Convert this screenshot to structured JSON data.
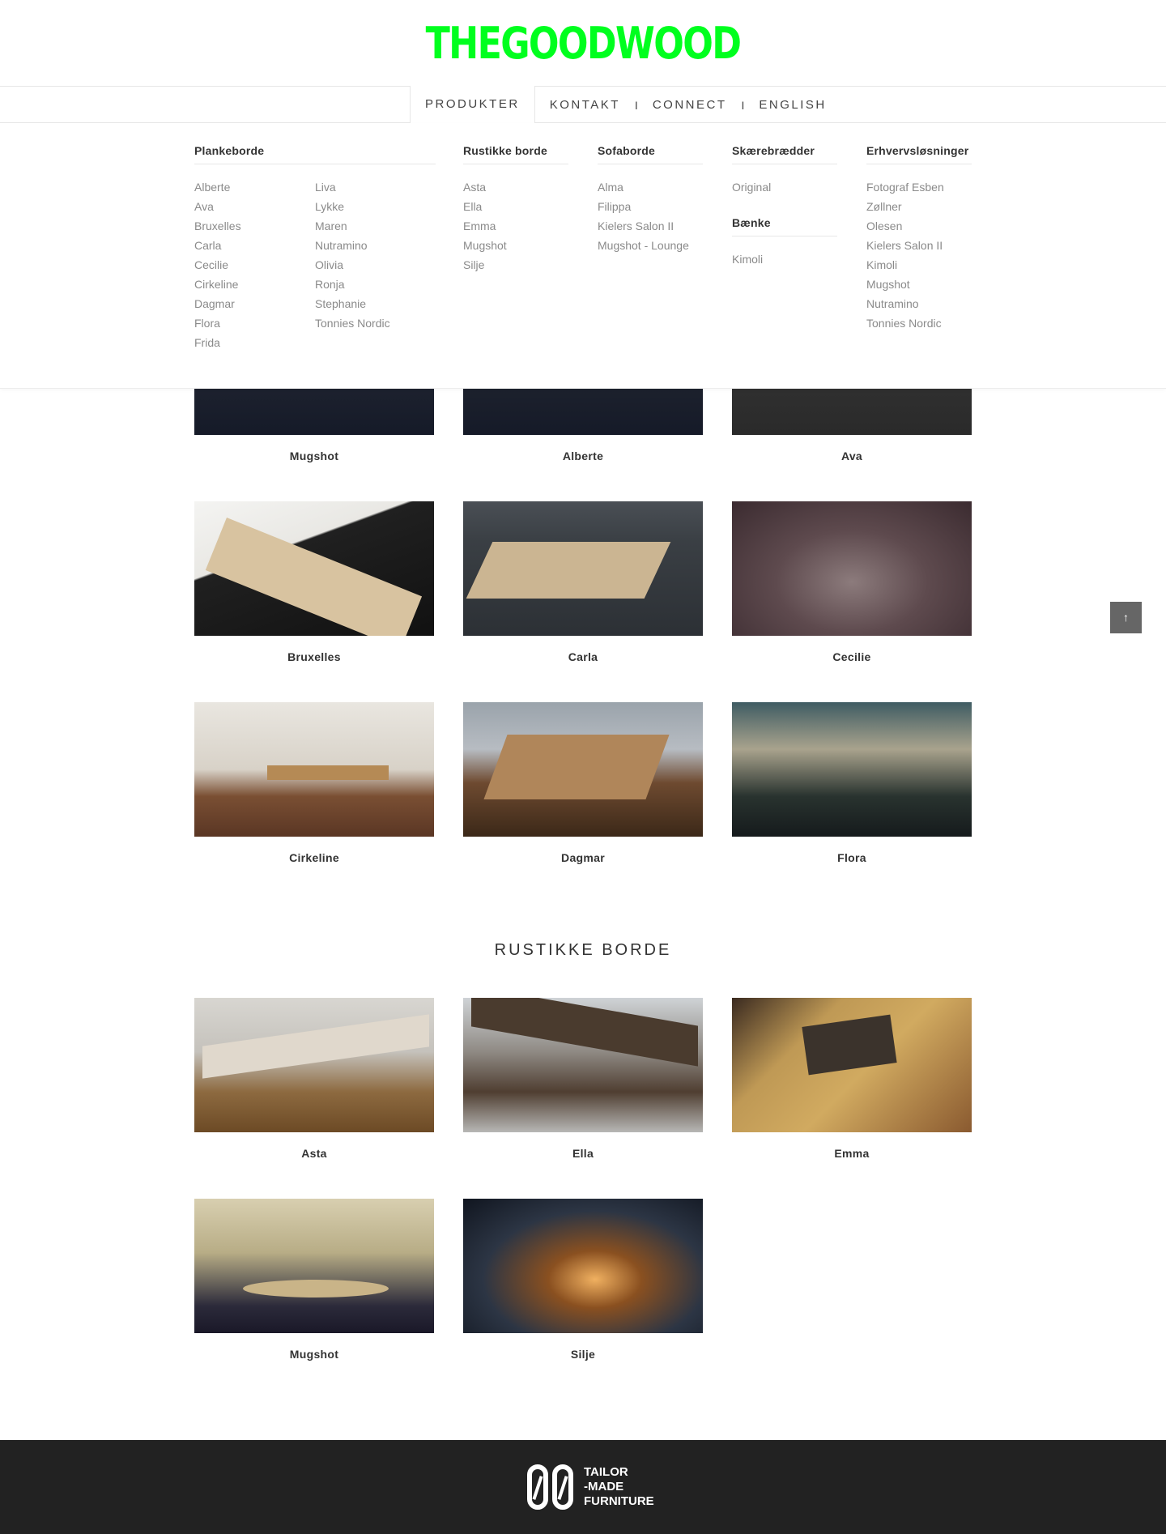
{
  "brand": {
    "logo_text": "THEGOODWOOD",
    "accent": "#00ff1e"
  },
  "nav": {
    "items": [
      "PRODUKTER",
      "KONTAKT",
      "CONNECT",
      "ENGLISH"
    ],
    "separator": "I"
  },
  "menu": {
    "plankeborde": {
      "title": "Plankeborde",
      "left": [
        "Alberte",
        "Ava",
        "Bruxelles",
        "Carla",
        "Cecilie",
        "Cirkeline",
        "Dagmar",
        "Flora",
        "Frida"
      ],
      "right": [
        "Liva",
        "Lykke",
        "Maren",
        "Nutramino",
        "Olivia",
        "Ronja",
        "Stephanie",
        "Tonnies Nordic"
      ]
    },
    "rustikke": {
      "title": "Rustikke borde",
      "items": [
        "Asta",
        "Ella",
        "Emma",
        "Mugshot",
        "Silje"
      ]
    },
    "sofaborde": {
      "title": "Sofaborde",
      "items": [
        "Alma",
        "Filippa",
        "Kielers Salon II",
        "Mugshot - Lounge"
      ]
    },
    "skaerebraedder": {
      "title": "Skærebrædder",
      "items": [
        "Original"
      ]
    },
    "baenke": {
      "title": "Bænke",
      "items": [
        "Kimoli"
      ]
    },
    "erhverv": {
      "title": "Erhvervsløsninger",
      "items": [
        "Fotograf Esben Zøllner",
        "Olesen",
        "Kielers Salon II",
        "Kimoli",
        "Mugshot",
        "Nutramino",
        "Tonnies Nordic"
      ]
    }
  },
  "products": {
    "row1": [
      "Mugshot",
      "Alberte",
      "Ava"
    ],
    "row2": [
      "Bruxelles",
      "Carla",
      "Cecilie"
    ],
    "row3": [
      "Cirkeline",
      "Dagmar",
      "Flora"
    ]
  },
  "rustikke_section": {
    "title": "RUSTIKKE BORDE",
    "row1": [
      "Asta",
      "Ella",
      "Emma"
    ],
    "row2": [
      "Mugshot",
      "Silje"
    ]
  },
  "scroll_top": {
    "icon": "arrow-up-icon",
    "glyph": "↑"
  },
  "footer": {
    "line1": "TAILOR",
    "line2": "-MADE",
    "line3": "FURNITURE"
  }
}
